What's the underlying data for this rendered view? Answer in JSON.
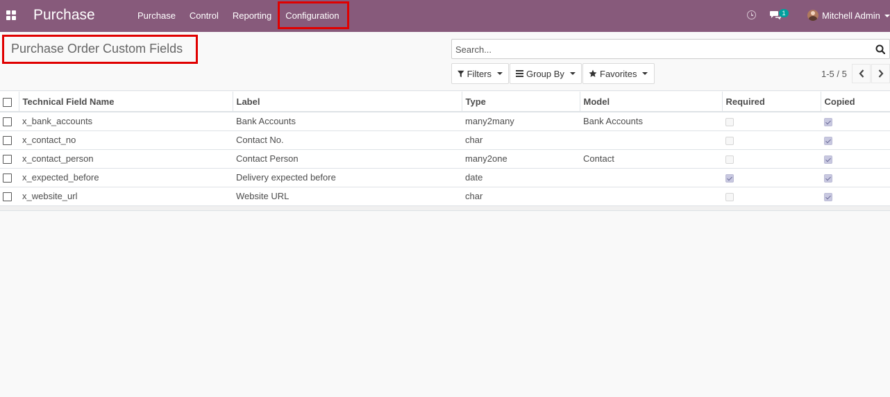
{
  "app": {
    "title": "Purchase"
  },
  "menu": [
    {
      "label": "Purchase"
    },
    {
      "label": "Control"
    },
    {
      "label": "Reporting"
    },
    {
      "label": "Configuration"
    }
  ],
  "systray": {
    "chat_badge": "1",
    "user_name": "Mitchell Admin"
  },
  "page": {
    "title": "Purchase Order Custom Fields"
  },
  "search": {
    "placeholder": "Search..."
  },
  "filters": {
    "filters_label": "Filters",
    "groupby_label": "Group By",
    "favorites_label": "Favorites"
  },
  "pager": {
    "value": "1-5 / 5"
  },
  "table": {
    "columns": [
      "Technical Field Name",
      "Label",
      "Type",
      "Model",
      "Required",
      "Copied"
    ],
    "rows": [
      {
        "name": "x_bank_accounts",
        "label": "Bank Accounts",
        "type": "many2many",
        "model": "Bank Accounts",
        "required": false,
        "copied": true
      },
      {
        "name": "x_contact_no",
        "label": "Contact No.",
        "type": "char",
        "model": "",
        "required": false,
        "copied": true
      },
      {
        "name": "x_contact_person",
        "label": "Contact Person",
        "type": "many2one",
        "model": "Contact",
        "required": false,
        "copied": true
      },
      {
        "name": "x_expected_before",
        "label": "Delivery expected before",
        "type": "date",
        "model": "",
        "required": true,
        "copied": true
      },
      {
        "name": "x_website_url",
        "label": "Website URL",
        "type": "char",
        "model": "",
        "required": false,
        "copied": true
      }
    ]
  },
  "colors": {
    "navbar": "#875a7b",
    "highlight": "#e00000",
    "badge": "#00a09d"
  }
}
